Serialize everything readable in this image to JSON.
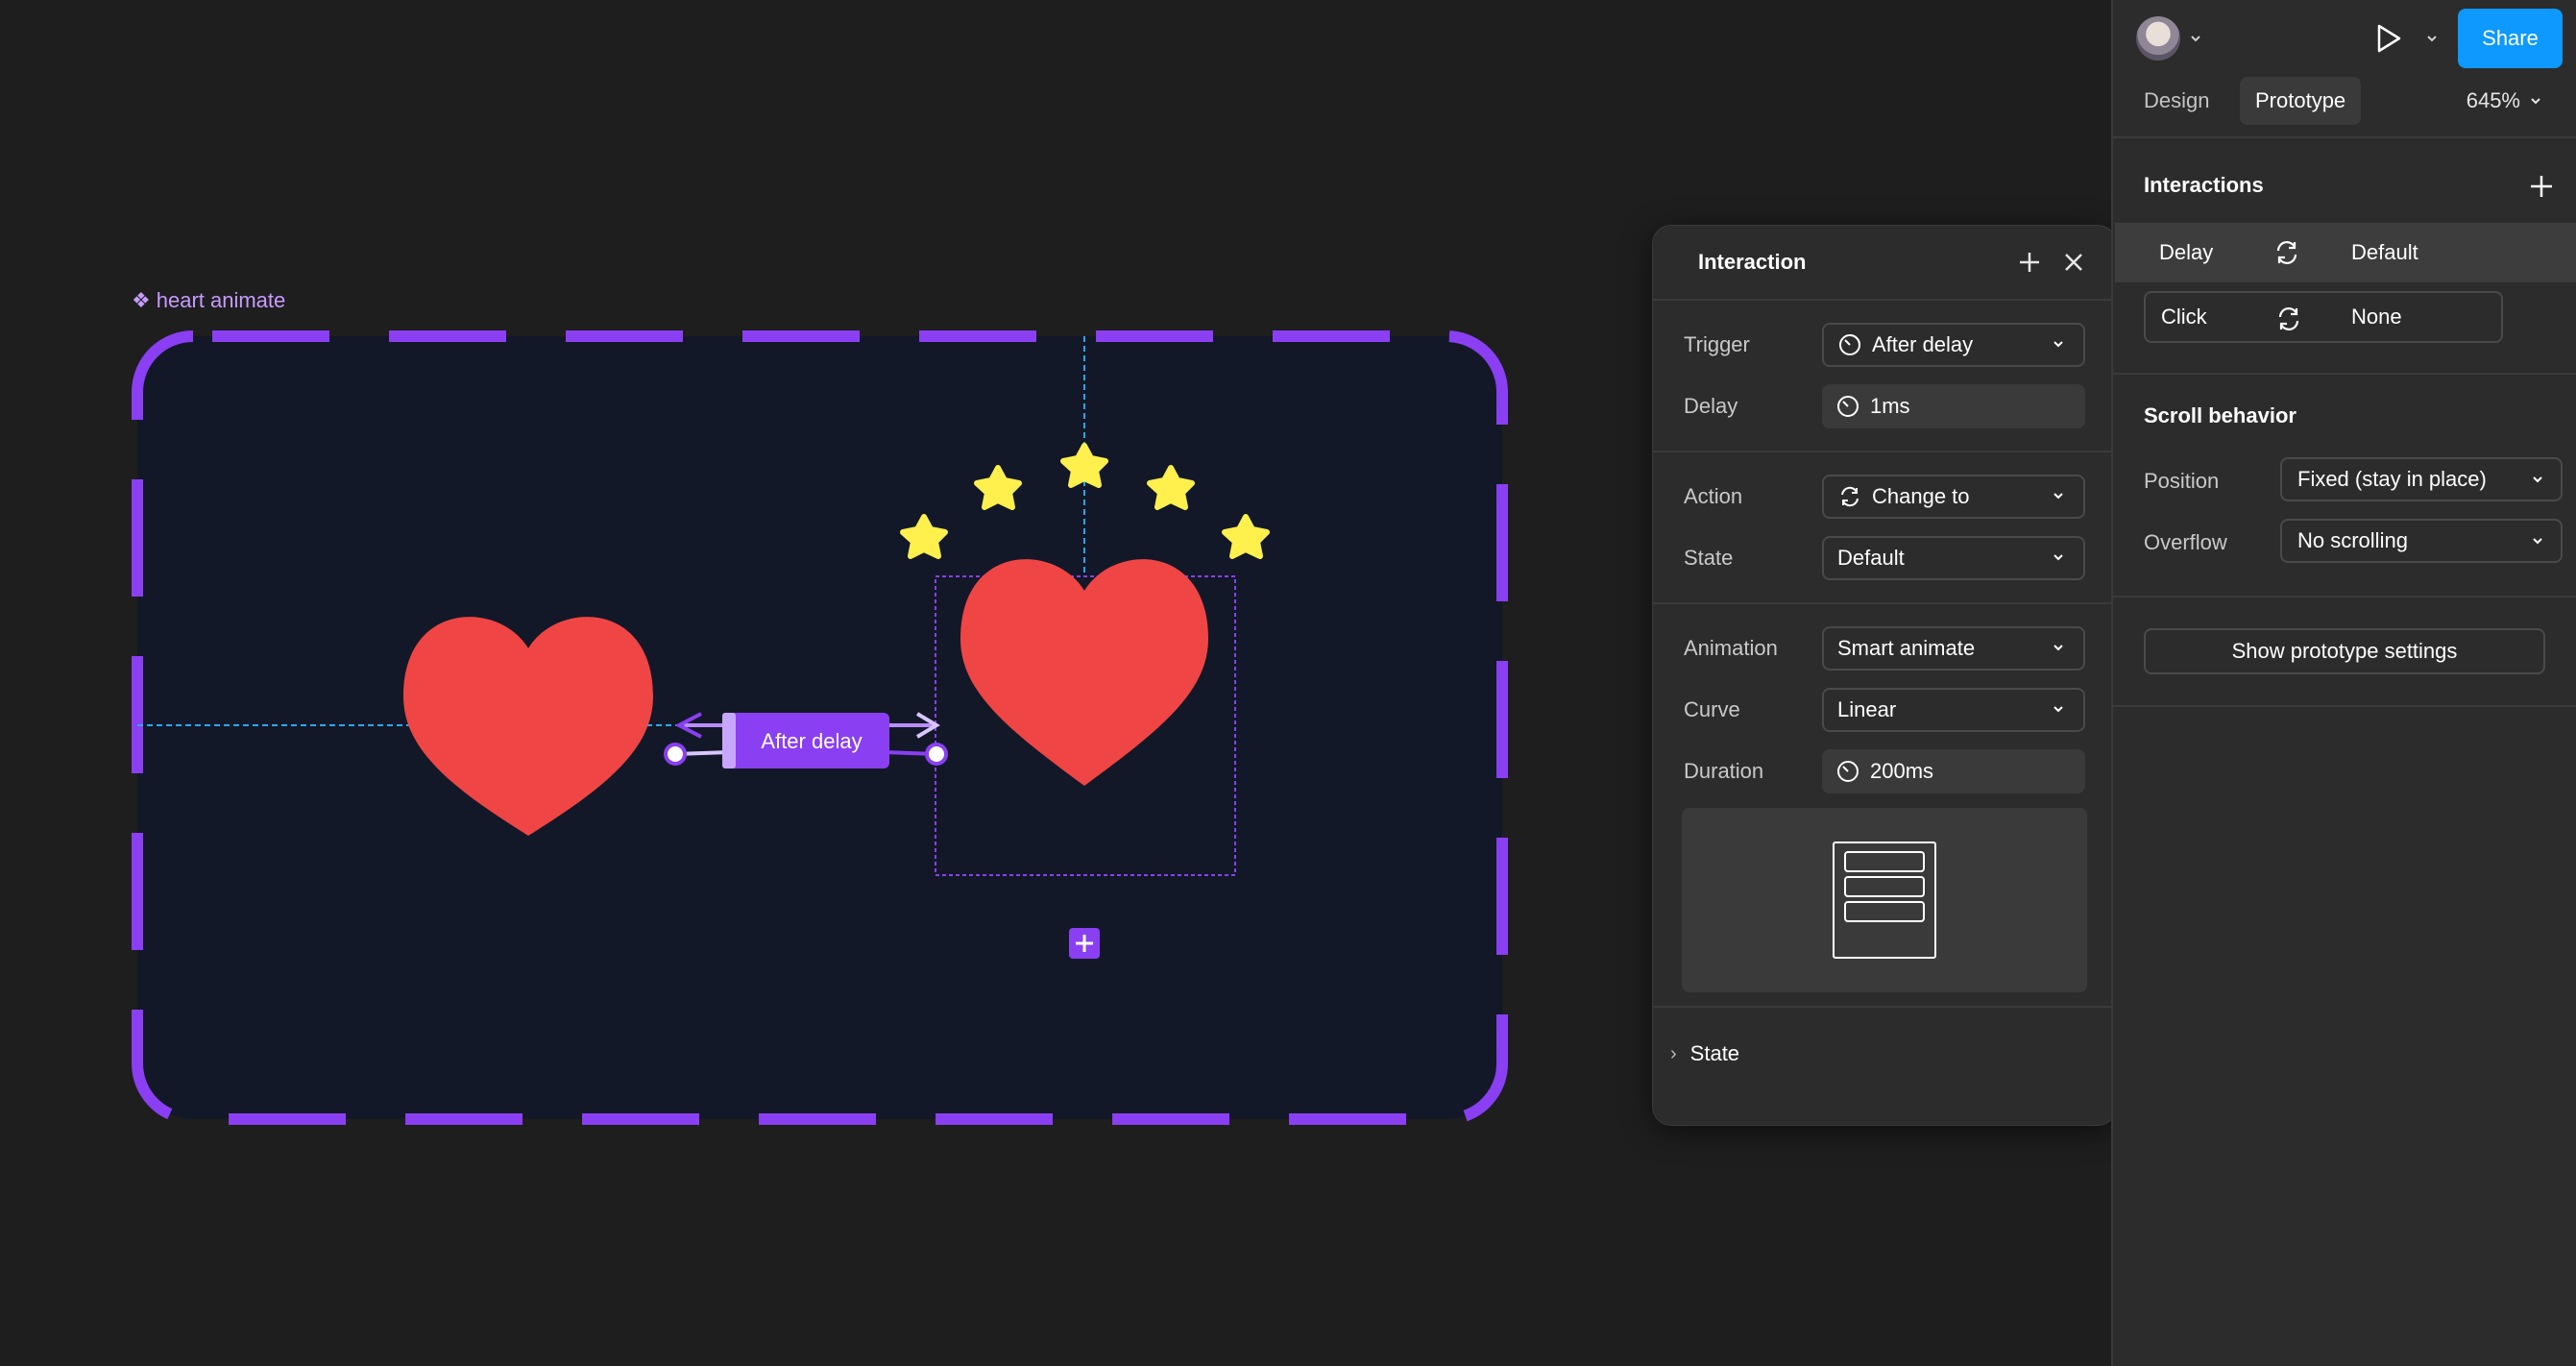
{
  "canvas": {
    "frame_label": "heart animate",
    "connector_label": "After delay",
    "colors": {
      "frame_fill": "#121827",
      "frame_border": "#8a3ff2",
      "heart": "#f04545",
      "star": "#fff04d",
      "guide": "#29a8ff"
    }
  },
  "interaction_panel": {
    "title": "Interaction",
    "rows": {
      "trigger": {
        "label": "Trigger",
        "value": "After delay",
        "icon": "timer-icon"
      },
      "delay": {
        "label": "Delay",
        "value": "1ms",
        "icon": "timer-icon"
      },
      "action": {
        "label": "Action",
        "value": "Change to",
        "icon": "swap-icon"
      },
      "state": {
        "label": "State",
        "value": "Default"
      },
      "animation": {
        "label": "Animation",
        "value": "Smart animate"
      },
      "curve": {
        "label": "Curve",
        "value": "Linear"
      },
      "duration": {
        "label": "Duration",
        "value": "200ms",
        "icon": "timer-icon"
      }
    },
    "state_section": "State"
  },
  "sidebar": {
    "share_label": "Share",
    "tabs": {
      "design": "Design",
      "prototype": "Prototype"
    },
    "zoom": "645%",
    "interactions_title": "Interactions",
    "interactions": [
      {
        "trigger": "Delay",
        "target": "Default"
      },
      {
        "trigger": "Click",
        "target": "None"
      }
    ],
    "scroll_behavior": {
      "title": "Scroll behavior",
      "position_label": "Position",
      "position_value": "Fixed (stay in place)",
      "overflow_label": "Overflow",
      "overflow_value": "No scrolling"
    },
    "prototype_settings_button": "Show prototype settings"
  }
}
